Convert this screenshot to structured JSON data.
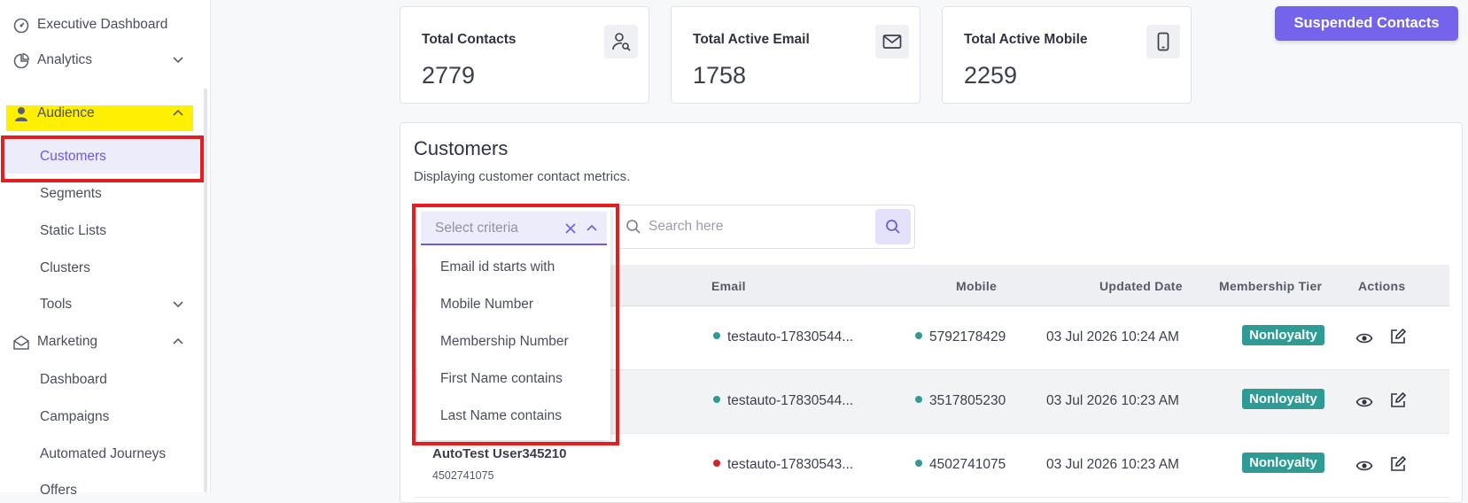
{
  "sidebar": {
    "items": [
      {
        "label": "Executive Dashboard",
        "icon": "dashboard-icon"
      },
      {
        "label": "Analytics",
        "icon": "analytics-icon"
      },
      {
        "label": "Audience",
        "icon": "user-icon"
      },
      {
        "label": "Marketing",
        "icon": "envelope-icon"
      }
    ],
    "audience_sub": [
      "Customers",
      "Segments",
      "Static Lists",
      "Clusters",
      "Tools"
    ],
    "marketing_sub": [
      "Dashboard",
      "Campaigns",
      "Automated Journeys",
      "Offers"
    ]
  },
  "stats": [
    {
      "title": "Total Contacts",
      "value": "2779",
      "icon": "contact-search-icon"
    },
    {
      "title": "Total Active Email",
      "value": "1758",
      "icon": "mail-icon"
    },
    {
      "title": "Total Active Mobile",
      "value": "2259",
      "icon": "mobile-icon"
    }
  ],
  "suspended_button": "Suspended Contacts",
  "customers": {
    "title": "Customers",
    "subtitle": "Displaying customer contact metrics.",
    "criteria_placeholder": "Select criteria",
    "search_placeholder": "Search here",
    "criteria_options": [
      "Email id starts with",
      "Mobile Number",
      "Membership Number",
      "First Name contains",
      "Last Name contains"
    ],
    "columns": [
      "Email",
      "Mobile",
      "Updated Date",
      "Membership Tier",
      "Actions"
    ],
    "rows": [
      {
        "name": "",
        "sub": "",
        "email": "testauto-17830544...",
        "email_status": "#2e9b95",
        "mobile": "5792178429",
        "mobile_status": "#2e9b95",
        "updated": "03 Jul 2026 10:24 AM",
        "tier": "Nonloyalty"
      },
      {
        "name": "",
        "sub": "",
        "email": "testauto-17830544...",
        "email_status": "#2e9b95",
        "mobile": "3517805230",
        "mobile_status": "#2e9b95",
        "updated": "03 Jul 2026 10:23 AM",
        "tier": "Nonloyalty"
      },
      {
        "name": "AutoTest User345210",
        "sub": "4502741075",
        "email": "testauto-17830543...",
        "email_status": "#d62424",
        "mobile": "4502741075",
        "mobile_status": "#2e9b95",
        "updated": "03 Jul 2026 10:23 AM",
        "tier": "Nonloyalty"
      }
    ]
  },
  "colors": {
    "accent": "#7464ec",
    "highlight": "#ffef00",
    "annotation": "#e41e1e",
    "tier_badge": "#2e9b95"
  }
}
